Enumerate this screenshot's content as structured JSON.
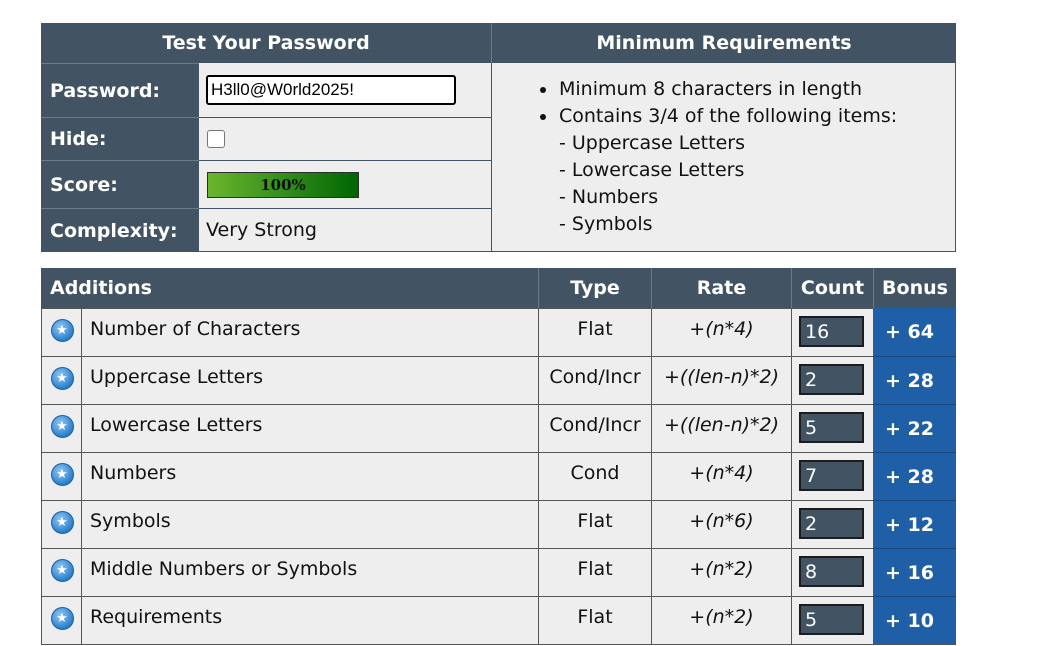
{
  "test": {
    "title": "Test Your Password",
    "password_label": "Password:",
    "password_value": "H3ll0@W0rld2025!",
    "hide_label": "Hide:",
    "hide_checked": false,
    "score_label": "Score:",
    "score_text": "100%",
    "score_fraction": 1.0,
    "complexity_label": "Complexity:",
    "complexity_value": "Very Strong"
  },
  "requirements": {
    "title": "Minimum Requirements",
    "item1": "Minimum 8 characters in length",
    "item2": "Contains 3/4 of the following items:",
    "sub": [
      "- Uppercase Letters",
      "- Lowercase Letters",
      "- Numbers",
      "- Symbols"
    ]
  },
  "additions": {
    "headers": {
      "additions": "Additions",
      "type": "Type",
      "rate": "Rate",
      "count": "Count",
      "bonus": "Bonus"
    },
    "rows": [
      {
        "name": "Number of Characters",
        "type": "Flat",
        "rate": "+(n*4)",
        "count": "16",
        "bonus": "+ 64"
      },
      {
        "name": "Uppercase Letters",
        "type": "Cond/Incr",
        "rate": "+((len-n)*2)",
        "count": "2",
        "bonus": "+ 28"
      },
      {
        "name": "Lowercase Letters",
        "type": "Cond/Incr",
        "rate": "+((len-n)*2)",
        "count": "5",
        "bonus": "+ 22"
      },
      {
        "name": "Numbers",
        "type": "Cond",
        "rate": "+(n*4)",
        "count": "7",
        "bonus": "+ 28"
      },
      {
        "name": "Symbols",
        "type": "Flat",
        "rate": "+(n*6)",
        "count": "2",
        "bonus": "+ 12"
      },
      {
        "name": "Middle Numbers or Symbols",
        "type": "Flat",
        "rate": "+(n*2)",
        "count": "8",
        "bonus": "+ 16"
      },
      {
        "name": "Requirements",
        "type": "Flat",
        "rate": "+(n*2)",
        "count": "5",
        "bonus": "+ 10"
      }
    ],
    "icon": "check-star-icon"
  },
  "colors": {
    "header": "#425463",
    "cell": "#eeeeee",
    "bonus": "#1f5fa8",
    "score_green": "#2f8a1a"
  }
}
